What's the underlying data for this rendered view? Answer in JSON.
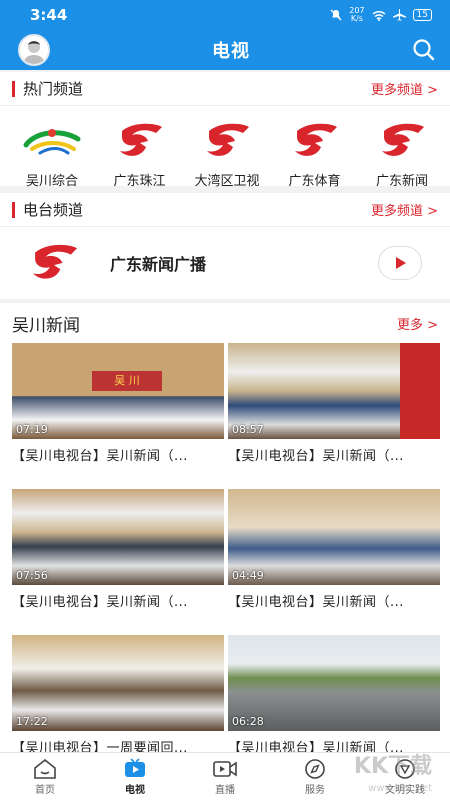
{
  "status": {
    "time": "3:44",
    "speed_top": "207",
    "speed_unit": "K/s",
    "battery": "15"
  },
  "header": {
    "title": "电视"
  },
  "hot_channels": {
    "title": "热门频道",
    "more": "更多频道 >",
    "items": [
      {
        "name": "吴川综合",
        "icon": "wuchuan-logo"
      },
      {
        "name": "广东珠江",
        "icon": "gdtv-logo"
      },
      {
        "name": "大湾区卫视",
        "icon": "gdtv-logo"
      },
      {
        "name": "广东体育",
        "icon": "gdtv-logo"
      },
      {
        "name": "广东新闻",
        "icon": "gdtv-logo"
      }
    ]
  },
  "radio": {
    "title": "电台频道",
    "more": "更多频道 >",
    "station": "广东新闻广播"
  },
  "news": {
    "title": "吴川新闻",
    "more": "更多 >",
    "items": [
      {
        "title": "【吴川电视台】吴川新闻（...",
        "duration": "07:19"
      },
      {
        "title": "【吴川电视台】吴川新闻（...",
        "duration": "08:57"
      },
      {
        "title": "【吴川电视台】吴川新闻（...",
        "duration": "07:56"
      },
      {
        "title": "【吴川电视台】吴川新闻（...",
        "duration": "04:49"
      },
      {
        "title": "【吴川电视台】一周要闻回...",
        "duration": "17:22"
      },
      {
        "title": "【吴川电视台】吴川新闻（...",
        "duration": "06:28"
      }
    ]
  },
  "tabbar": {
    "items": [
      {
        "label": "首页"
      },
      {
        "label": "电视"
      },
      {
        "label": "直播"
      },
      {
        "label": "服务"
      },
      {
        "label": "文明实践"
      }
    ]
  },
  "watermark": {
    "text": "KK下载",
    "url": "www.kkx.net"
  },
  "colors": {
    "primary": "#1c8fe6",
    "accent": "#d9262c"
  }
}
